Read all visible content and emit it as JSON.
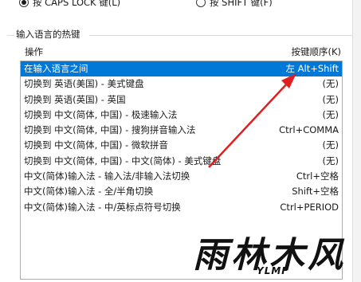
{
  "hotkey_radios": [
    {
      "label": "按 CAPS LOCK 键(L)",
      "checked": true
    },
    {
      "label": "按 SHIFT 键(F)",
      "checked": false
    }
  ],
  "group_title": "输入语言的热键",
  "columns": {
    "action": "操作",
    "keys": "按键顺序(K)"
  },
  "rows": [
    {
      "action": "在输入语言之间",
      "keys": "左 Alt+Shift",
      "selected": true
    },
    {
      "action": "切换到 英语(美国) - 美式键盘",
      "keys": "(无)"
    },
    {
      "action": "切换到 英语(英国) - 英国",
      "keys": "(无)"
    },
    {
      "action": "切换到 中文(简体, 中国) - 极速输入法",
      "keys": "(无)"
    },
    {
      "action": "切换到 中文(简体, 中国) - 搜狗拼音输入法",
      "keys": "Ctrl+COMMA"
    },
    {
      "action": "切换到 中文(简体, 中国) - 微软拼音",
      "keys": "(无)"
    },
    {
      "action": "切换到 中文(简体, 中国) - 中文(简体) - 美式键盘",
      "keys": "(无)"
    },
    {
      "action": "中文(简体)输入法 - 输入法/非输入法切换",
      "keys": "Ctrl+空格"
    },
    {
      "action": "中文(简体)输入法 - 全/半角切换",
      "keys": "Shift+空格"
    },
    {
      "action": "中文(简体)输入法 - 中/英标点符号切换",
      "keys": "Ctrl+PERIOD"
    }
  ],
  "watermark": {
    "main": "雨林木风",
    "sub": "YLMF"
  },
  "colors": {
    "selection": "#0078d7",
    "arrow": "#e02020"
  }
}
